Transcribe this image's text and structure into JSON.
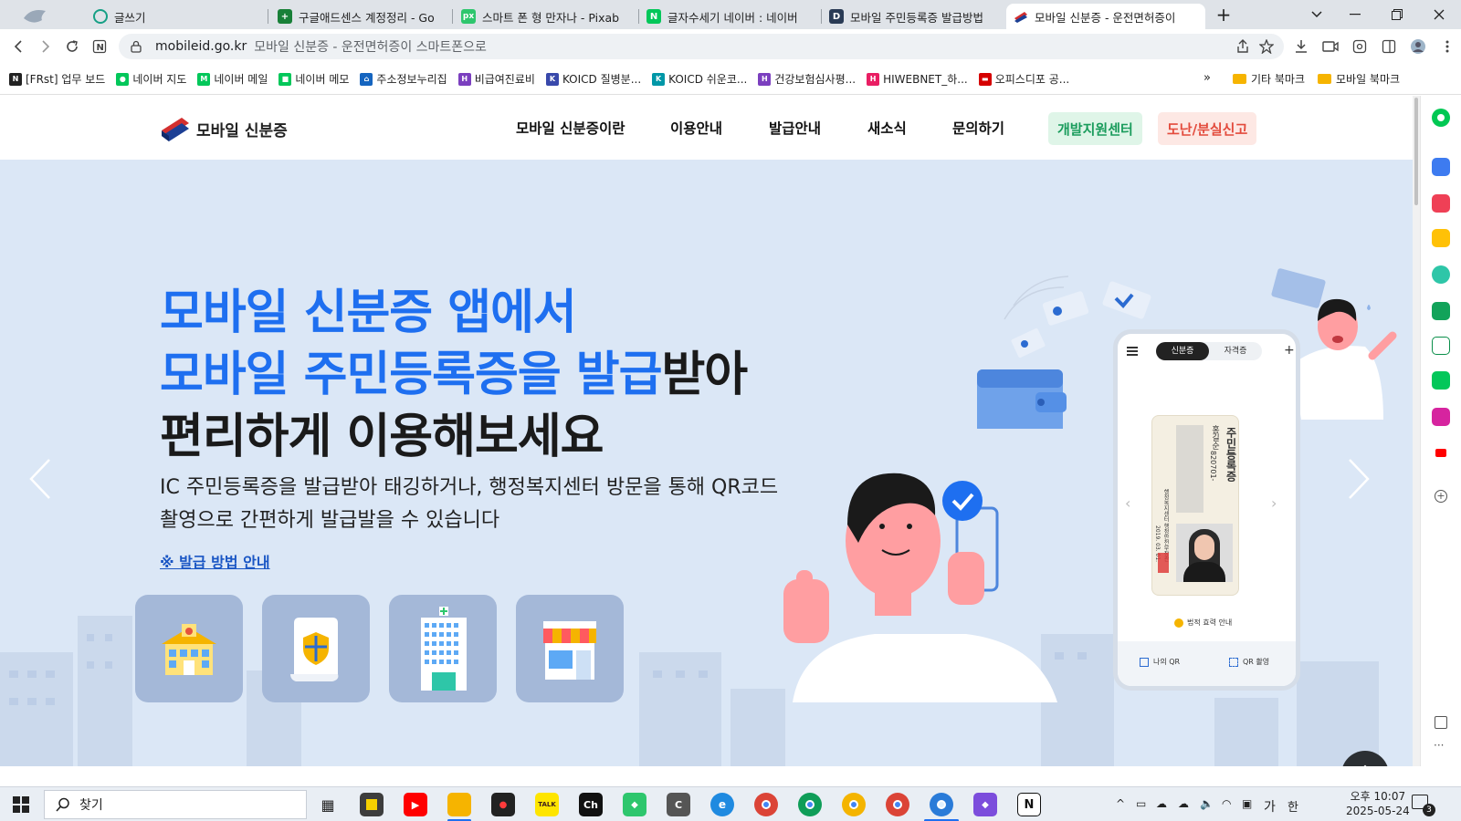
{
  "browser": {
    "tabs": [
      {
        "label": "글쓰기",
        "icon": "ring-icon",
        "color": "#16a085"
      },
      {
        "label": "구글애드센스 계정정리 - Go",
        "icon": "sheets-icon",
        "color": "#188038"
      },
      {
        "label": "스마트 폰 형 만자나 - Pixab",
        "icon": "pixabay-icon",
        "color": "#2ec66d"
      },
      {
        "label": "글자수세기 네이버 : 네이버",
        "icon": "naver-icon",
        "color": "#03c75a"
      },
      {
        "label": "모바일 주민등록증 발급방법",
        "icon": "d-icon",
        "color": "#2a3b55"
      },
      {
        "label": "모바일 신분증 - 운전면허증이",
        "icon": "mobileid-icon",
        "color": "#d32f2f"
      }
    ],
    "new_tab": "+",
    "url": "mobileid.go.kr",
    "page_title": "모바일 신분증 - 운전면허증이 스마트폰으로",
    "bookmarks": [
      {
        "label": "[FRst] 업무 보드",
        "color": "#222222",
        "glyph": "N"
      },
      {
        "label": "네이버 지도",
        "color": "#03c75a",
        "glyph": "●"
      },
      {
        "label": "네이버 메일",
        "color": "#03c75a",
        "glyph": "M"
      },
      {
        "label": "네이버 메모",
        "color": "#03c75a",
        "glyph": "■"
      },
      {
        "label": "주소정보누리집",
        "color": "#1565c0",
        "glyph": "⌂"
      },
      {
        "label": "비급여진료비",
        "color": "#7b3fbf",
        "glyph": "H"
      },
      {
        "label": "KOICD 질병분...",
        "color": "#3949ab",
        "glyph": "K"
      },
      {
        "label": "KOICD 쉬운코...",
        "color": "#0097a7",
        "glyph": "K"
      },
      {
        "label": "건강보험심사평...",
        "color": "#7b3fbf",
        "glyph": "H"
      },
      {
        "label": "HIWEBNET_하...",
        "color": "#e91e63",
        "glyph": "H"
      },
      {
        "label": "오피스디포 공...",
        "color": "#d50000",
        "glyph": "▬"
      }
    ],
    "bookmarks_more": "»",
    "folders": [
      "기타 북마크",
      "모바일 북마크"
    ]
  },
  "site": {
    "logo_text": "모바일 신분증",
    "nav": [
      "모바일 신분증이란",
      "이용안내",
      "발급안내",
      "새소식",
      "문의하기"
    ],
    "dev_center": "개발지원센터",
    "lost_report": "도난/분실신고"
  },
  "hero": {
    "title_line1": "모바일 신분증 앱에서",
    "title_line2_blue": "모바일 주민등록증을 발급",
    "title_line2_dark": "받아",
    "title_line3": "편리하게 이용해보세요",
    "desc_line1": "IC 주민등록증을 발급받아 태깅하거나, 행정복지센터 방문을 통해 QR코드",
    "desc_line2": "촬영으로 간편하게 발급발을 수 있습니다",
    "link": "※ 발급 방법 안내",
    "cards": [
      "school-icon",
      "certificate-icon",
      "hospital-icon",
      "store-icon"
    ]
  },
  "phone": {
    "tab_active": "신분증",
    "tab_inactive": "자격증",
    "card_title": "주민등록증",
    "card_name": "홍길순",
    "card_number": "820701-",
    "card_issuer": "행정복지센터 행정안전부장관",
    "card_date": "2019. 03. 01.",
    "notice": "법적 효력 안내",
    "my_qr": "나의 QR",
    "qr_scan": "QR 촬영"
  },
  "taskbar": {
    "search_placeholder": "찾기",
    "apps": [
      {
        "name": "task-view-icon",
        "color": "#e9eef4",
        "glyph": "▦"
      },
      {
        "name": "sticky-notes-icon",
        "color": "#3d3d3d",
        "glyph": ""
      },
      {
        "name": "youtube-icon",
        "color": "#ff0000",
        "glyph": "▶"
      },
      {
        "name": "file-explorer-icon",
        "color": "#f6b400",
        "glyph": ""
      },
      {
        "name": "recorder-icon",
        "color": "#222222",
        "glyph": "●"
      },
      {
        "name": "kakaotalk-icon",
        "color": "#fee500",
        "glyph": "TALK"
      },
      {
        "name": "channel-icon",
        "color": "#111111",
        "glyph": "Ch"
      },
      {
        "name": "3d-app-icon",
        "color": "#2ec66d",
        "glyph": "◆"
      },
      {
        "name": "c-app-icon",
        "color": "#555555",
        "glyph": "C"
      },
      {
        "name": "edge-icon",
        "color": "#1f8ae0",
        "glyph": "e"
      },
      {
        "name": "chrome-icon-1",
        "color": "#db4437",
        "glyph": "◉"
      },
      {
        "name": "chrome-icon-2",
        "color": "#db4437",
        "glyph": "◉"
      },
      {
        "name": "chrome-icon-3",
        "color": "#db4437",
        "glyph": "◉"
      },
      {
        "name": "chrome-icon-4",
        "color": "#db4437",
        "glyph": "◉"
      },
      {
        "name": "chrome-icon-5",
        "color": "#2a7bd8",
        "glyph": "◉"
      },
      {
        "name": "obsidian-icon",
        "color": "#7c4ddc",
        "glyph": "◆"
      },
      {
        "name": "notion-icon",
        "color": "#ffffff",
        "glyph": "N"
      }
    ],
    "ime_mode": "가",
    "ime_lang": "한",
    "time": "오후 10:07",
    "date": "2025-05-24",
    "notifications": "3"
  },
  "colors": {
    "brand_blue": "#1e6ff0",
    "hero_bg": "#dbe7f6",
    "dev_green": "#1a9c5c",
    "lost_red": "#e34b3d"
  }
}
